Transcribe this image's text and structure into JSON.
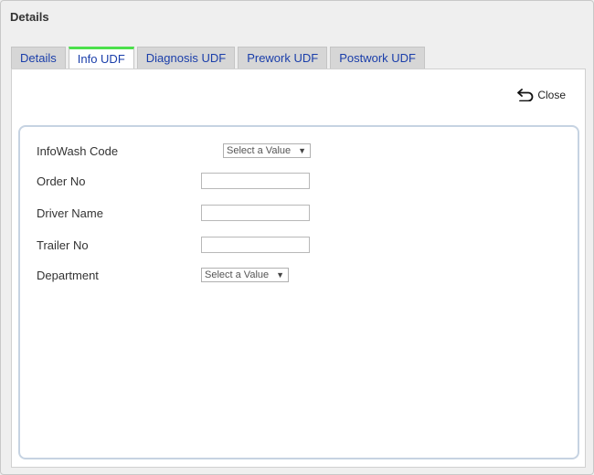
{
  "dialog": {
    "title": "Details"
  },
  "tabs": [
    {
      "label": "Details",
      "active": false
    },
    {
      "label": "Info UDF",
      "active": true
    },
    {
      "label": "Diagnosis UDF",
      "active": false
    },
    {
      "label": "Prework UDF",
      "active": false
    },
    {
      "label": "Postwork UDF",
      "active": false
    }
  ],
  "toolbar": {
    "close_label": "Close"
  },
  "form": {
    "infowash_code": {
      "label": "InfoWash Code",
      "value": "Select a Value"
    },
    "order_no": {
      "label": "Order No",
      "value": ""
    },
    "driver_name": {
      "label": "Driver Name",
      "value": ""
    },
    "trailer_no": {
      "label": "Trailer No",
      "value": ""
    },
    "department": {
      "label": "Department",
      "value": "Select a Value"
    }
  },
  "colors": {
    "active_tab_accent": "#4ce04c",
    "tab_text": "#1a3eaa",
    "form_border": "#c6d3e2"
  }
}
